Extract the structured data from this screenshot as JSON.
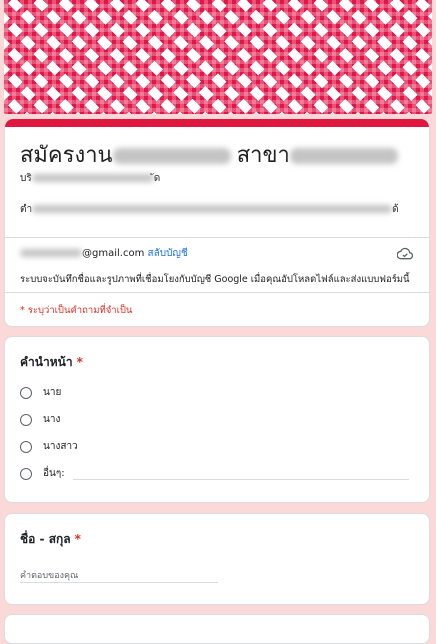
{
  "form": {
    "title_prefix": "สมัครงาน",
    "title_middle": "สาขา",
    "company_prefix": "บริ",
    "company_suffix": "ัด",
    "desc_prefix": "ตำ",
    "desc_suffix": "ด้",
    "email_domain": "@gmail.com",
    "switch_account": "สลับบัญชี",
    "notice": "ระบบจะบันทึกชื่อและรูปภาพที่เชื่อมโยงกับบัญชี Google เมื่อคุณอัปโหลดไฟล์และส่งแบบฟอร์มนี้",
    "required_note": "* ระบุว่าเป็นคำถามที่จำเป็น"
  },
  "questions": [
    {
      "title": "คำนำหน้า",
      "required_mark": "*",
      "options": [
        "นาย",
        "นาง",
        "นางสาว",
        "อื่นๆ:"
      ]
    },
    {
      "title": "ชื่อ - สกุล",
      "required_mark": "*",
      "placeholder": "คำตอบของคุณ"
    }
  ],
  "colors": {
    "accent": "#e0173f",
    "background": "#fbd9d9",
    "link": "#1a73e8",
    "required": "#d93025"
  }
}
